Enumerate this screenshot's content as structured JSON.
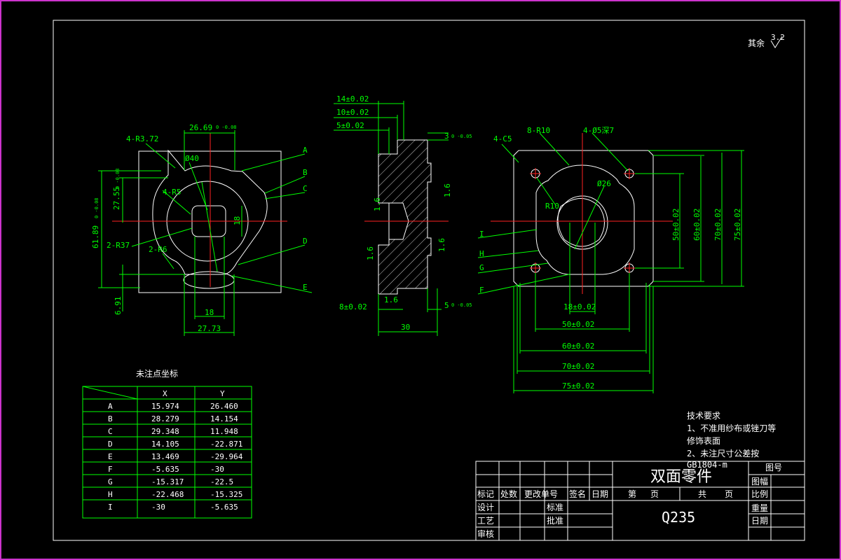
{
  "roughness": {
    "label": "其余",
    "value": "3.2"
  },
  "front_view": {
    "dim_top": "26.69",
    "dim_top_tol": "0 -0.08",
    "r_corner": "4-R3.72",
    "dia_circle": "Ø40",
    "r5": "4-R5",
    "r37": "2-R37",
    "r6": "2-R6",
    "dim_left1": "61.89",
    "dim_left1_tol": "0 -0.08",
    "dim_left2": "27.55",
    "dim_left2_tol": "0 -0.08",
    "dim_6": "6.91",
    "dim_18_v": "18",
    "dim_18_h": "18",
    "dim_27": "27.73",
    "letters": [
      "A",
      "B",
      "C",
      "D",
      "E"
    ]
  },
  "side_view": {
    "d14": "14±0.02",
    "d10": "10±0.02",
    "d5": "5±0.02",
    "d3": "3",
    "d3_tol": "0 -0.05",
    "r16a": "1.6",
    "r16b": "1.6",
    "r16c": "1.6",
    "r16d": "1.6",
    "r16e": "1.6",
    "d8": "8±0.02",
    "d5b": "5",
    "d5b_tol": "0 -0.05",
    "d30": "30"
  },
  "top_view": {
    "c5": "4-C5",
    "r10a": "8-R10",
    "holes": "4-Ø5深7",
    "d26": "Ø26",
    "r10b": "R10",
    "v50": "50±0.02",
    "v60": "60±0.02",
    "v70": "70±0.02",
    "v75": "75±0.02",
    "h18": "18±0.02",
    "h50": "50±0.02",
    "h60": "60±0.02",
    "h70": "70±0.02",
    "h75": "75±0.02",
    "letters": [
      "I",
      "H",
      "G",
      "F"
    ]
  },
  "coord_table": {
    "title": "未注点坐标",
    "headers": [
      "",
      "X",
      "Y"
    ],
    "rows": [
      [
        "A",
        "15.974",
        "26.460"
      ],
      [
        "B",
        "28.279",
        "14.154"
      ],
      [
        "C",
        "29.348",
        "11.948"
      ],
      [
        "D",
        "14.105",
        "-22.871"
      ],
      [
        "E",
        "13.469",
        "-29.964"
      ],
      [
        "F",
        "-5.635",
        "-30"
      ],
      [
        "G",
        "-15.317",
        "-22.5"
      ],
      [
        "H",
        "-22.468",
        "-15.325"
      ],
      [
        "I",
        "-30",
        "-5.635"
      ]
    ]
  },
  "tech_req": {
    "title": "技术要求",
    "line1": "1、不准用纱布或锉刀等",
    "line2": "修饰表面",
    "line3": "2、未注尺寸公差按",
    "line4": "GB1804-m"
  },
  "title_block": {
    "part_name": "双面零件",
    "material": "Q235",
    "drawing_no": "图号",
    "sheet_size": "图幅",
    "scale": "比例",
    "weight": "重量",
    "date": "日期",
    "mark": "标记",
    "count": "处数",
    "change_no": "更改单号",
    "sign": "签名",
    "date2": "日期",
    "sheet_no": "第",
    "sheet_unit": "页",
    "total": "共",
    "total_unit": "页",
    "design": "设计",
    "craft": "工艺",
    "review": "审核",
    "standard": "标准",
    "approve": "批准"
  }
}
